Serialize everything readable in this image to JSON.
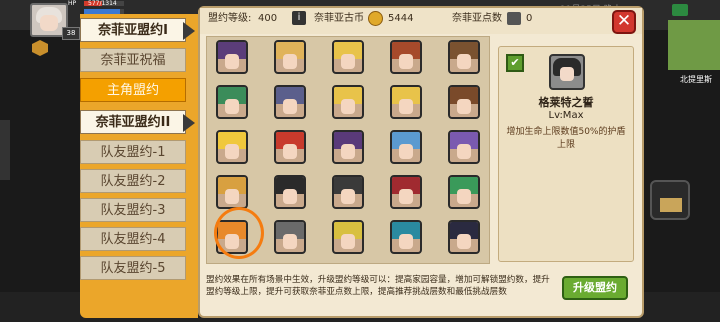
{
  "hud": {
    "level": "38",
    "hp_text": "577/1314",
    "mp_text": "HP",
    "clock_text": "11月25日 晚上"
  },
  "sidebar": {
    "items": [
      {
        "label": "奈菲亚盟约I",
        "kind": "group"
      },
      {
        "label": "奈菲亚祝福",
        "kind": "grey"
      },
      {
        "label": "主角盟约",
        "kind": "active"
      },
      {
        "label": "奈菲亚盟约II",
        "kind": "group"
      },
      {
        "label": "队友盟约-1",
        "kind": "grey"
      },
      {
        "label": "队友盟约-2",
        "kind": "grey"
      },
      {
        "label": "队友盟约-3",
        "kind": "grey"
      },
      {
        "label": "队友盟约-4",
        "kind": "grey"
      },
      {
        "label": "队友盟约-5",
        "kind": "grey"
      }
    ]
  },
  "topbar": {
    "alliance_level_label": "盟约等级:",
    "alliance_level_value": "400",
    "coin_label": "奈菲亚古币",
    "coin_value": "5444",
    "points_label": "奈菲亚点数",
    "points_value": "0",
    "close_label": "✕"
  },
  "grid": {
    "characters": [
      {
        "hair": "#5b3d7a"
      },
      {
        "hair": "#e0b35a"
      },
      {
        "hair": "#e8c34a"
      },
      {
        "hair": "#a64a2b"
      },
      {
        "hair": "#7a5230"
      },
      {
        "hair": "#3b8c5a"
      },
      {
        "hair": "#5b5f8c"
      },
      {
        "hair": "#e8c34a"
      },
      {
        "hair": "#e8c34a"
      },
      {
        "hair": "#7a4a2a"
      },
      {
        "hair": "#f0c83c"
      },
      {
        "hair": "#c83a2c"
      },
      {
        "hair": "#5a3a7a"
      },
      {
        "hair": "#5b9ad0"
      },
      {
        "hair": "#7a5ab0"
      },
      {
        "hair": "#d8a040"
      },
      {
        "hair": "#2a2a2a"
      },
      {
        "hair": "#3a3a3a"
      },
      {
        "hair": "#a02a30"
      },
      {
        "hair": "#3a9a5a"
      },
      {
        "hair": "#e8892a"
      },
      {
        "hair": "#6a6a6a"
      },
      {
        "hair": "#d8c040"
      },
      {
        "hair": "#2a8aa0"
      },
      {
        "hair": "#2a2a40"
      }
    ]
  },
  "detail": {
    "name": "格莱特之誓",
    "level": "Lv:Max",
    "description": "增加生命上限数值50%的护盾上限",
    "check": "✔"
  },
  "footer": {
    "description": "盟约效果在所有场景中生效，升级盟约等级可以：提高家园容量，增加可解锁盟约数，提升盟约等级上限，提升可获取奈菲亚点数上限，提高推荐挑战层数和最低挑战层数",
    "upgrade_label": "升级盟约"
  },
  "map": {
    "location": "北提里斯"
  },
  "colors": {
    "accent": "#eba62a",
    "panel": "#f3e9d3",
    "close": "#d2372e",
    "upgrade": "#6aab31",
    "selection_ring": "#f57c10"
  }
}
